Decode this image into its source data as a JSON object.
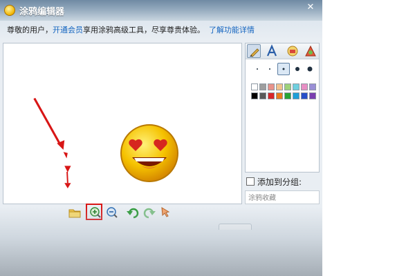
{
  "window": {
    "title": "涂鸦编辑器",
    "close_glyph": "✕"
  },
  "notice": {
    "prefix": "尊敬的用户，",
    "vip_link": "开通会员",
    "middle": "享用涂鸦高级工具，尽享尊贵体验。",
    "details_link": "了解功能详情"
  },
  "panel": {
    "group_label": "添加到分组:",
    "hint_text": "涂鸦收藏"
  },
  "colors": {
    "accent": "#1565c0",
    "highlight": "#d81616",
    "palette": [
      "#ffffff",
      "#9e9e9e",
      "#e8928a",
      "#f2c38e",
      "#9ed27a",
      "#6fd0df",
      "#e88fc4",
      "#9a8fd6",
      "#000000",
      "#5a5a5a",
      "#d8262a",
      "#e87d1e",
      "#27a436",
      "#1f9fd8",
      "#2650c8",
      "#7a3fb0"
    ]
  },
  "icons": {
    "toolbar": [
      "open-folder-icon",
      "zoom-in-icon",
      "zoom-out-icon",
      "undo-icon",
      "redo-icon",
      "pointer-icon"
    ],
    "tabs": [
      "brush-icon",
      "text-icon",
      "sticker-icon",
      "shape-icon"
    ]
  }
}
